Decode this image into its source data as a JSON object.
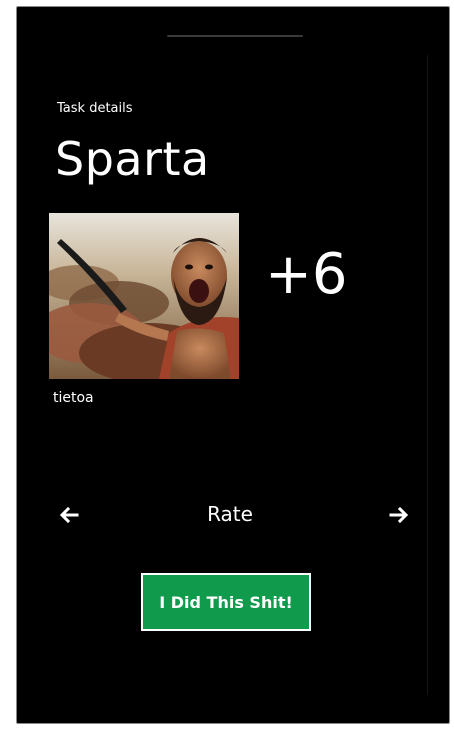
{
  "header": {
    "subtitle": "Task details",
    "title": "Sparta"
  },
  "task": {
    "image_subject": "spartan-warrior-photo",
    "score": "+6",
    "owner": "tietoa"
  },
  "rating": {
    "label": "Rate",
    "prev_icon": "arrow-left-icon",
    "next_icon": "arrow-right-icon"
  },
  "action": {
    "button_label": "I Did This Shit!",
    "button_color": "#0f9a4c"
  },
  "colors": {
    "background": "#000000",
    "text": "#ffffff",
    "accent": "#0f9a4c"
  }
}
